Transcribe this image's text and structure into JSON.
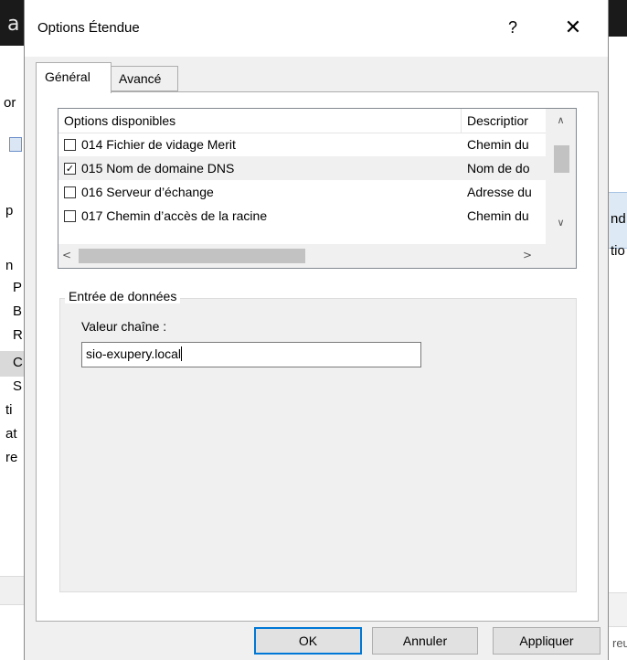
{
  "background": {
    "left_fragments": [
      "a",
      "or",
      "p",
      "n",
      "P",
      "B",
      "R",
      "C",
      "S",
      "ti",
      "at",
      "re"
    ],
    "right_fragments": [
      "nd",
      "tio",
      "reu"
    ]
  },
  "dialog": {
    "title": "Options Étendue",
    "help_label": "?",
    "close_label": "✕",
    "tabs": [
      {
        "label": "Général",
        "active": true
      },
      {
        "label": "Avancé",
        "active": false
      }
    ],
    "options_table": {
      "columns": [
        "Options disponibles",
        "Descriptior"
      ],
      "rows": [
        {
          "name": "014 Fichier de vidage Merit",
          "description": "Chemin du",
          "checked": false
        },
        {
          "name": "015 Nom de domaine DNS",
          "description": "Nom de do",
          "checked": true
        },
        {
          "name": "016 Serveur d’échange",
          "description": "Adresse du",
          "checked": false
        },
        {
          "name": "017 Chemin d’accès de la racine",
          "description": "Chemin du",
          "checked": false
        }
      ]
    },
    "data_entry": {
      "legend": "Entrée de données",
      "field_label": "Valeur chaîne :",
      "field_value": "sio-exupery.local"
    },
    "buttons": {
      "ok": "OK",
      "cancel": "Annuler",
      "apply": "Appliquer"
    }
  }
}
